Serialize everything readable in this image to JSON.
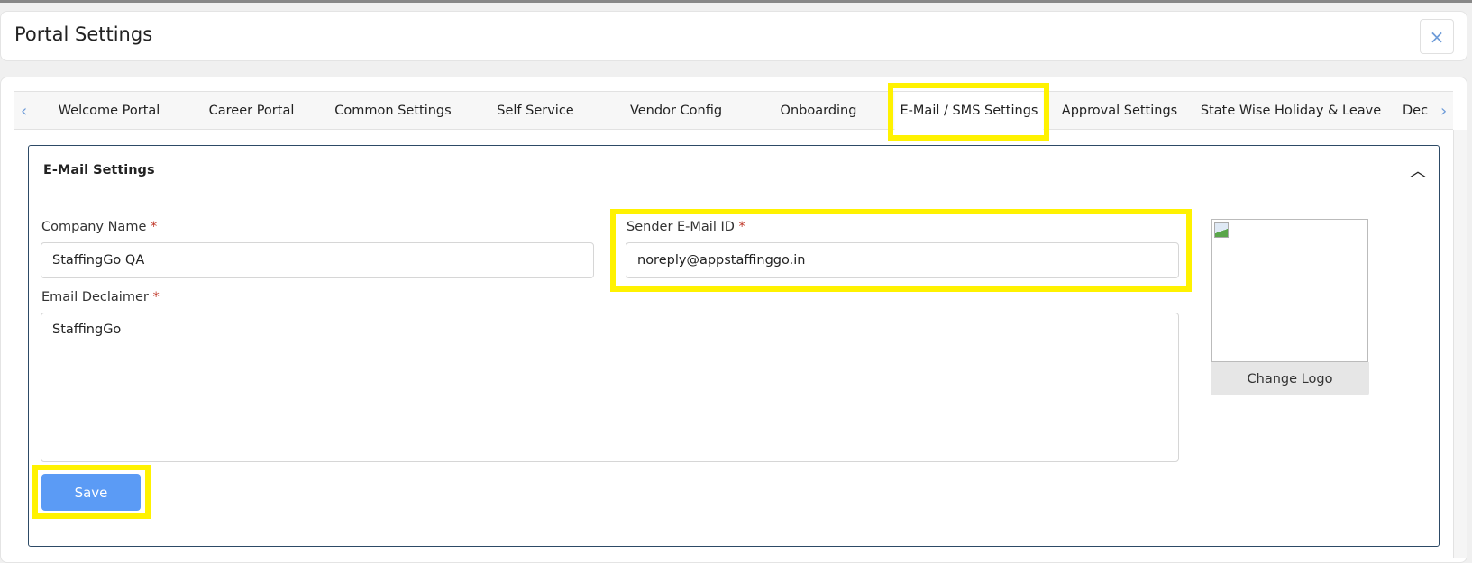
{
  "header": {
    "title": "Portal Settings",
    "close_icon": "×"
  },
  "tabs": [
    "Welcome Portal",
    "Career Portal",
    "Common Settings",
    "Self Service",
    "Vendor Config",
    "Onboarding",
    "E-Mail / SMS Settings",
    "Approval Settings",
    "State Wise Holiday & Leave",
    "Dec"
  ],
  "active_tab": "E-Mail / SMS Settings",
  "panel": {
    "title": "E-Mail Settings",
    "company_name": {
      "label": "Company Name",
      "required": "*",
      "value": "StaffingGo QA"
    },
    "sender_email": {
      "label": "Sender E-Mail ID",
      "required": "*",
      "value": "noreply@appstaffinggo.in"
    },
    "disclaimer": {
      "label": "Email Declaimer",
      "required": "*",
      "value": "StaffingGo"
    },
    "save_label": "Save",
    "change_logo_label": "Change Logo"
  },
  "colors": {
    "accent": "#5b9bf5",
    "highlight": "#fff200",
    "panel_border": "#2d4a66"
  }
}
